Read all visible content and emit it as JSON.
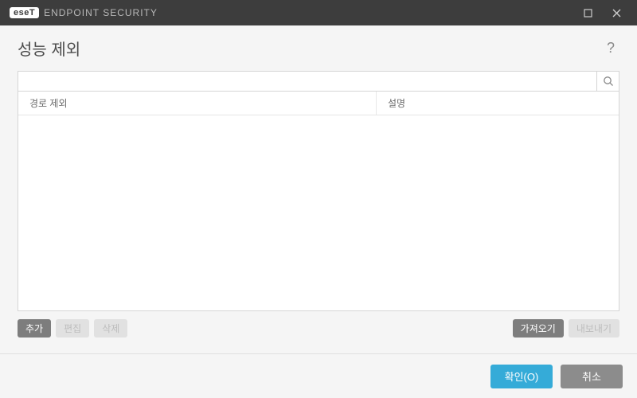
{
  "titlebar": {
    "brand_badge": "eseT",
    "product_name": "ENDPOINT SECURITY"
  },
  "page": {
    "title": "성능 제외"
  },
  "search": {
    "value": "",
    "placeholder": ""
  },
  "table": {
    "columns": {
      "path": "경로 제외",
      "description": "설명"
    },
    "rows": []
  },
  "actions": {
    "add": "추가",
    "edit": "편집",
    "delete": "삭제",
    "import": "가져오기",
    "export": "내보내기"
  },
  "footer": {
    "ok": "확인(O)",
    "cancel": "취소"
  },
  "icons": {
    "help": "?",
    "maximize": "maximize-icon",
    "close": "close-icon",
    "search": "search-icon"
  }
}
